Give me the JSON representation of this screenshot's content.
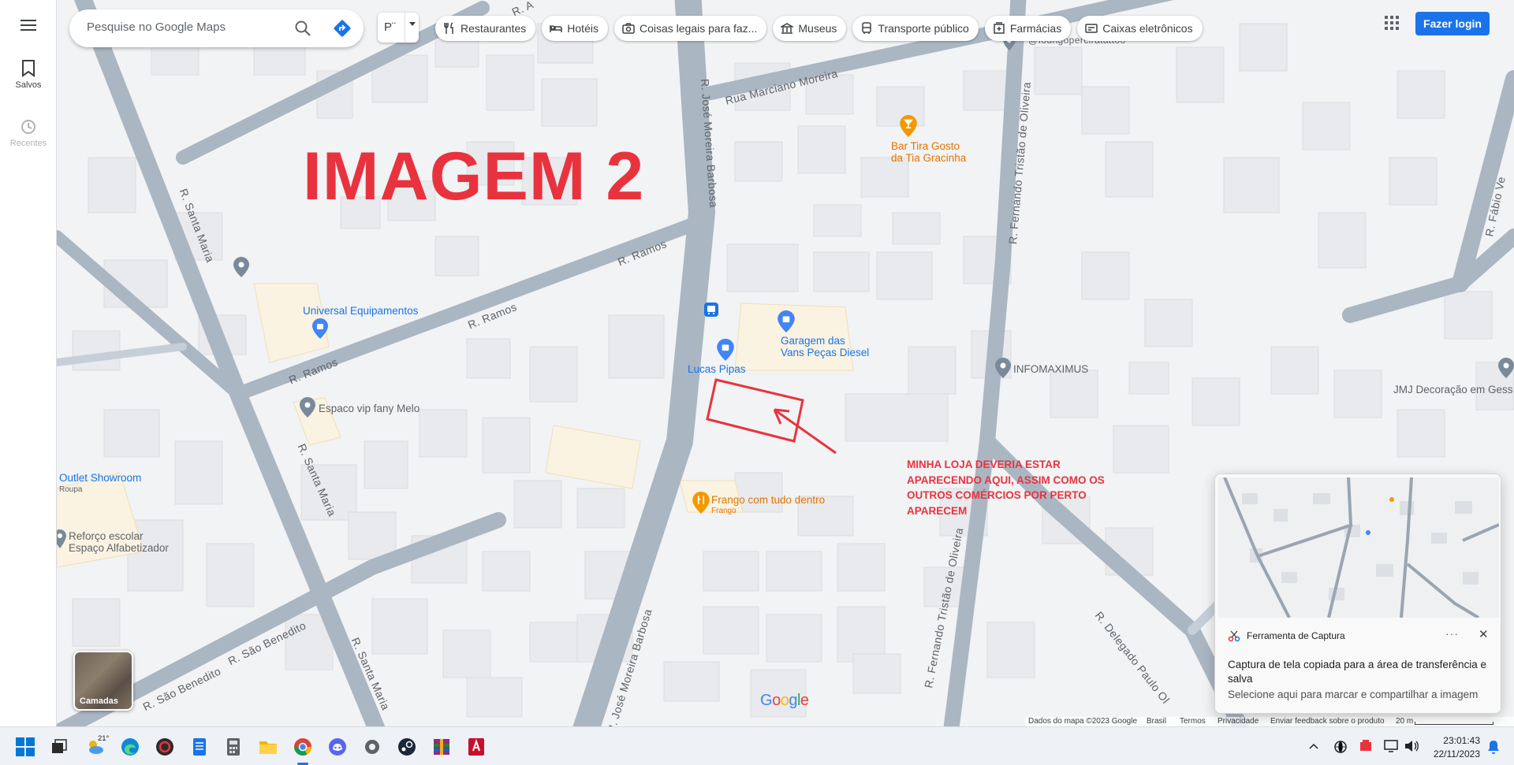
{
  "rail": {
    "menu_icon": "hamburger-icon",
    "saved_label": "Salvos",
    "recent_label": "Recentes"
  },
  "search": {
    "placeholder": "Pesquise no Google Maps"
  },
  "layer_toggle": {
    "label": "P¨"
  },
  "chips": [
    {
      "label": "Restaurantes",
      "icon": "fork-knife-icon"
    },
    {
      "label": "Hotéis",
      "icon": "bed-icon"
    },
    {
      "label": "Coisas legais para faz...",
      "icon": "camera-icon"
    },
    {
      "label": "Museus",
      "icon": "museum-icon"
    },
    {
      "label": "Transporte público",
      "icon": "bus-icon"
    },
    {
      "label": "Farmácias",
      "icon": "pharmacy-icon"
    },
    {
      "label": "Caixas eletrônicos",
      "icon": "atm-icon"
    }
  ],
  "login_label": "Fazer login",
  "annotation": {
    "title": "IMAGEM 2",
    "note": "MINHA LOJA DEVERIA ESTAR APARECENDO AQUI, ASSIM COMO OS OUTROS COMÉRCIOS POR PERTO APARECEM",
    "color": "#e8333f"
  },
  "streets": {
    "s1": "R. Santa Maria",
    "s2": "R. Santa Maria",
    "s3": "R. Santa Maria",
    "s4": "R. Ramos",
    "s5": "R. Ramos",
    "s6": "R. Ramos",
    "s7": "R. José Moreira Barbosa",
    "s8": "R. José Moreira Barbosa",
    "s9": "Rua Marciano Moreira",
    "s10": "R. Fernando Tristão de Oliveira",
    "s11": "R. Fernando Tristão de Oliveira",
    "s12": "R. São Benedito",
    "s13": "R. São Benedito",
    "s14": "R. Delegado Paulo Ol",
    "s15": "R. Fábio Ve",
    "s16": "R. A",
    "s17": "@foungoperciratattoo"
  },
  "pois": {
    "universal": "Universal Equipamentos",
    "espaco_vip": "Espaco vip fany Melo",
    "outlet": "Outlet Showroom",
    "outlet_sub": "Roupa",
    "reforco1": "Reforço escolar",
    "reforco2": "Espaço Alfabetizador",
    "lucas": "Lucas Pipas",
    "garagem1": "Garagem das",
    "garagem2": "Vans Peças Diesel",
    "bar1": "Bar Tira Gosto",
    "bar2": "da Tia Gracinha",
    "frango": "Frango com tudo dentro",
    "frango_sub": "Frango",
    "infomaximus": "INFOMAXIMUS",
    "jmj": "JMJ Decoração em Gess"
  },
  "layers_label": "Camadas",
  "google_logo": {
    "letters": [
      "G",
      "o",
      "o",
      "g",
      "l",
      "e"
    ],
    "colors": [
      "#4285f4",
      "#ea4335",
      "#fbbc05",
      "#4285f4",
      "#34a853",
      "#ea4335"
    ]
  },
  "footer": {
    "map_data": "Dados do mapa ©2023 Google",
    "country": "Brasil",
    "terms": "Termos",
    "privacy": "Privacidade",
    "feedback": "Enviar feedback sobre o produto",
    "scale": "20 m"
  },
  "toast": {
    "app_name": "Ferramenta de Captura",
    "more": "···",
    "close": "✕",
    "message": "Captura de tela copiada para a área de transferência e salva",
    "sub": "Selecione aqui para marcar e compartilhar a imagem"
  },
  "taskbar": {
    "weather_temp": "21°",
    "time": "23:01:43",
    "date": "22/11/2023"
  }
}
